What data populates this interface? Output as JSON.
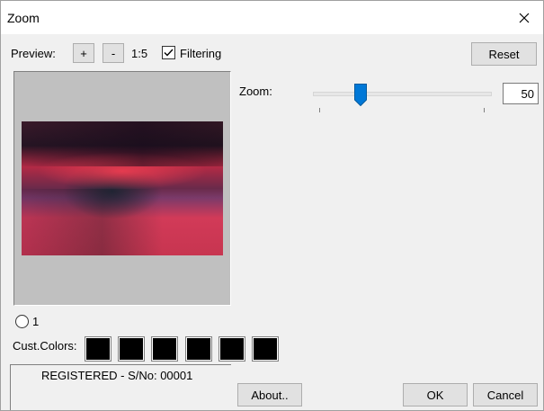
{
  "window": {
    "title": "Zoom"
  },
  "toolbar": {
    "preview_label": "Preview:",
    "plus_label": "+",
    "minus_label": "-",
    "ratio": "1:5",
    "filtering_label": "Filtering",
    "filtering_checked": true,
    "reset_label": "Reset"
  },
  "zoom": {
    "label": "Zoom:",
    "value": "50",
    "slider_min": 0,
    "slider_max": 200,
    "slider_value": 50
  },
  "radio": {
    "label": "1",
    "selected": false
  },
  "colors": {
    "label": "Cust.Colors:",
    "swatches": [
      "#000000",
      "#000000",
      "#000000",
      "#000000",
      "#000000",
      "#000000"
    ],
    "accent": "#0078d7"
  },
  "status": {
    "text": "REGISTERED - S/No: 00001"
  },
  "buttons": {
    "about": "About..",
    "ok": "OK",
    "cancel": "Cancel"
  }
}
